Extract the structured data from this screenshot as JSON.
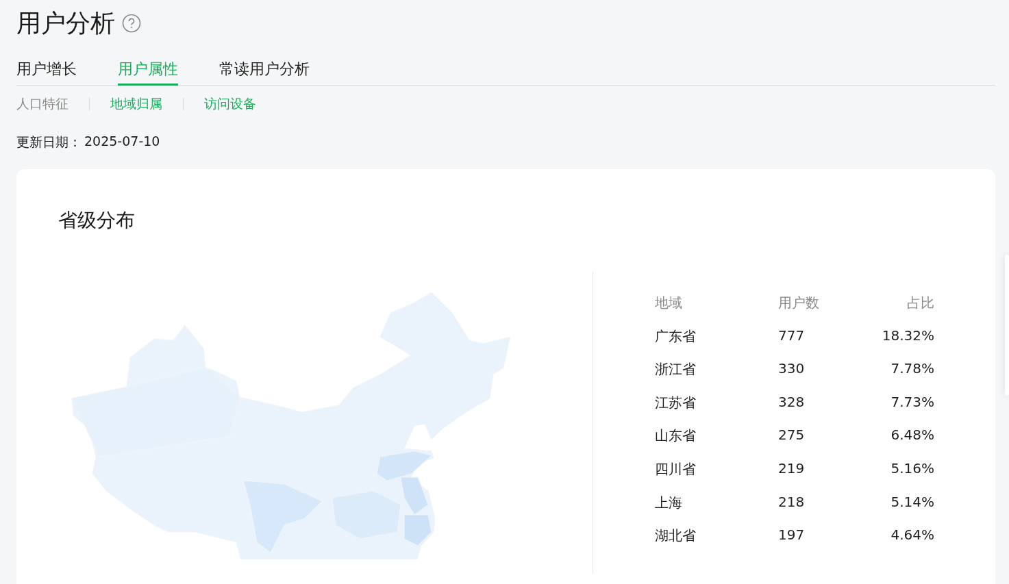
{
  "page_title": "用户分析",
  "tabs": [
    {
      "label": "用户增长",
      "selected": false
    },
    {
      "label": "用户属性",
      "selected": true
    },
    {
      "label": "常读用户分析",
      "selected": false
    }
  ],
  "sub_tabs": [
    {
      "label": "人口特征",
      "active": false
    },
    {
      "label": "地域归属",
      "active": true
    },
    {
      "label": "访问设备",
      "active": true
    }
  ],
  "update_date": {
    "label": "更新日期：",
    "value": "2025-07-10"
  },
  "card": {
    "title": "省级分布",
    "table": {
      "columns": [
        "地域",
        "用户数",
        "占比"
      ],
      "rows": [
        [
          "广东省",
          "777",
          "18.32%"
        ],
        [
          "浙江省",
          "330",
          "7.78%"
        ],
        [
          "江苏省",
          "328",
          "7.73%"
        ],
        [
          "山东省",
          "275",
          "6.48%"
        ],
        [
          "四川省",
          "219",
          "5.16%"
        ],
        [
          "上海",
          "218",
          "5.14%"
        ],
        [
          "湖北省",
          "197",
          "4.64%"
        ]
      ]
    }
  }
}
